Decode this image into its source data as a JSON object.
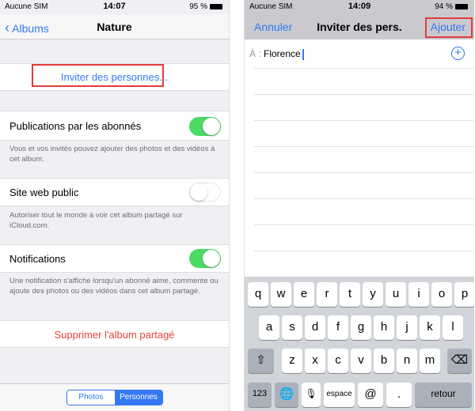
{
  "left": {
    "status": {
      "carrier": "Aucune SIM",
      "time": "14:07",
      "battery": "95 %"
    },
    "nav": {
      "back": "Albums",
      "title": "Nature"
    },
    "invite": "Inviter des personnes...",
    "settings": [
      {
        "label": "Publications par les abonnés",
        "on": true,
        "footer": "Vous et vos invités pouvez ajouter des photos et des vidéos à cet album."
      },
      {
        "label": "Site web public",
        "on": false,
        "footer": "Autoriser tout le monde à voir cet album partagé sur iCloud.com."
      },
      {
        "label": "Notifications",
        "on": true,
        "footer": "Une notification s'affiche lorsqu'un abonné aime, commente ou ajoute des photos ou des vidéos dans cet album partagé."
      }
    ],
    "delete": "Supprimer l'album partagé",
    "segments": [
      "Photos",
      "Personnes"
    ],
    "selected_segment": "Personnes"
  },
  "right": {
    "status": {
      "carrier": "Aucune SIM",
      "time": "14:09",
      "battery": "94 %"
    },
    "nav": {
      "cancel": "Annuler",
      "title": "Inviter des pers.",
      "add": "Ajouter"
    },
    "to_label": "À :",
    "to_value": "Florence",
    "keyboard": {
      "row1": [
        "q",
        "w",
        "e",
        "r",
        "t",
        "y",
        "u",
        "i",
        "o",
        "p"
      ],
      "row2": [
        "a",
        "s",
        "d",
        "f",
        "g",
        "h",
        "j",
        "k",
        "l"
      ],
      "row3": [
        "z",
        "x",
        "c",
        "v",
        "b",
        "n",
        "m"
      ],
      "numbers": "123",
      "space": "espace",
      "at": "@",
      "dot": ".",
      "return": "retour"
    }
  },
  "colors": {
    "accent": "#3478f6",
    "toggle_on": "#4cd964",
    "destructive": "#e5443a",
    "highlight_box": "#e23b3b"
  }
}
